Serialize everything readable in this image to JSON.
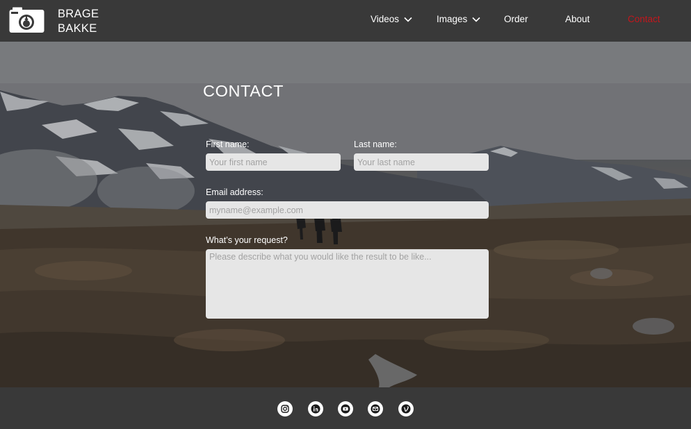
{
  "brand": {
    "line1": "BRAGE",
    "line2": "BAKKE",
    "logo_icon": "camera-icon"
  },
  "nav": {
    "items": [
      {
        "label": "Videos",
        "dropdown": true
      },
      {
        "label": "Images",
        "dropdown": true
      },
      {
        "label": "Order",
        "dropdown": false
      },
      {
        "label": "About",
        "dropdown": false
      },
      {
        "label": "Contact",
        "dropdown": false,
        "active": true
      }
    ]
  },
  "colors": {
    "header_bg": "#393939",
    "active_nav": "#c4161c",
    "field_bg": "#e6e6e6",
    "text": "#ffffff"
  },
  "contact": {
    "title": "CONTACT",
    "first_name": {
      "label": "First name:",
      "placeholder": "Your first name",
      "value": ""
    },
    "last_name": {
      "label": "Last name:",
      "placeholder": "Your last name",
      "value": ""
    },
    "email": {
      "label": "Email address:",
      "placeholder": "myname@example.com",
      "value": ""
    },
    "request": {
      "label": "What’s your request?",
      "placeholder": "Please describe what you would like the result to be like...",
      "value": ""
    }
  },
  "footer": {
    "social": [
      "instagram-icon",
      "linkedin-icon",
      "youtube-icon",
      "mail-icon",
      "vimeo-icon"
    ]
  }
}
